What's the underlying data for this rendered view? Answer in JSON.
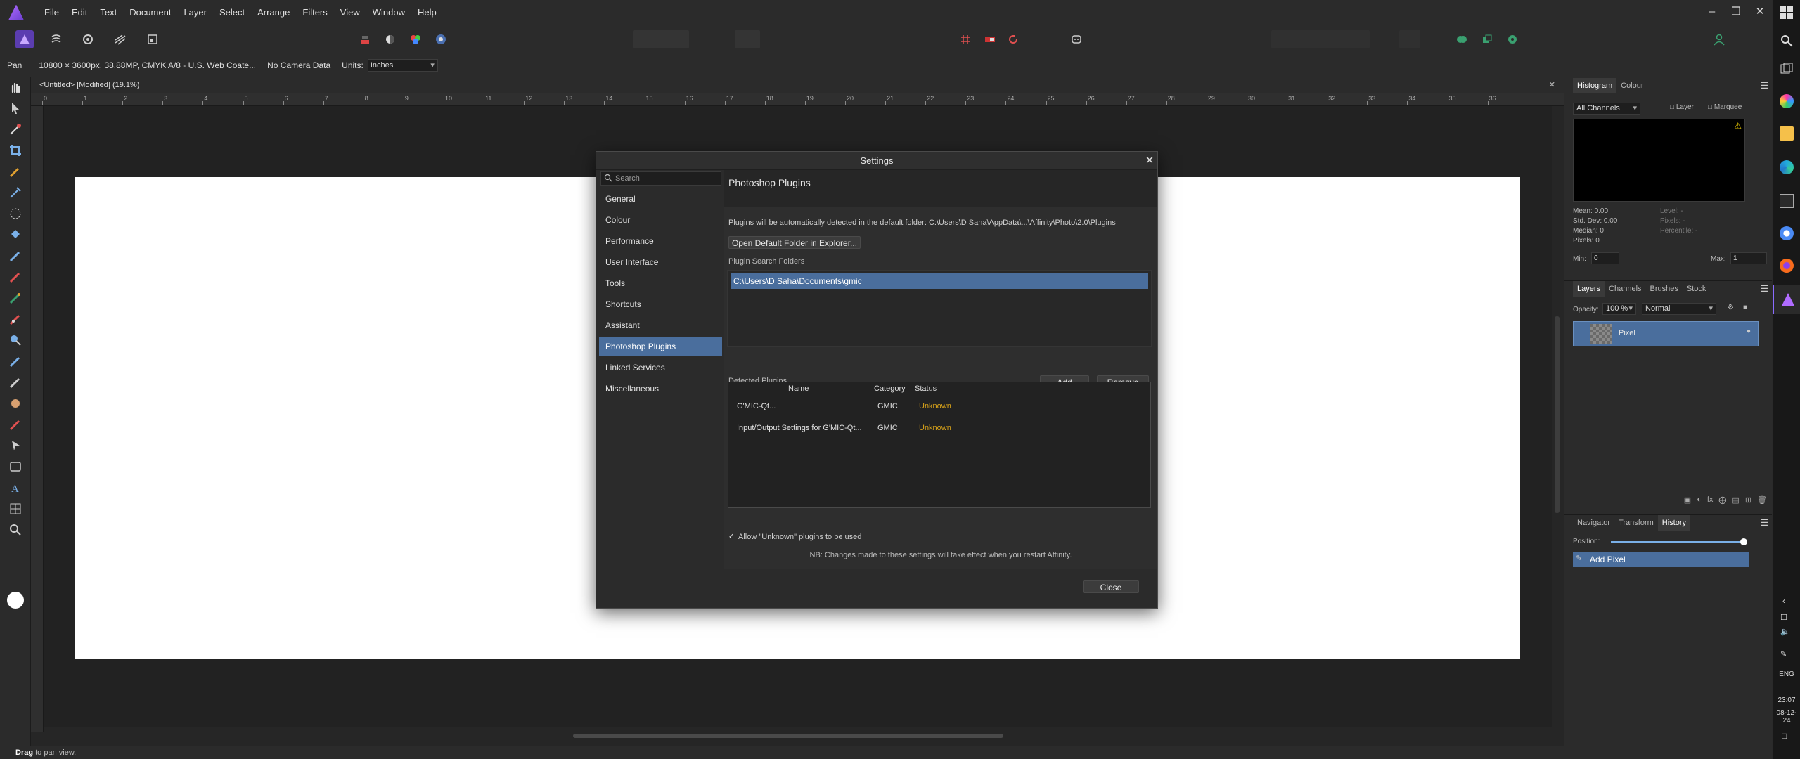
{
  "menu": [
    "File",
    "Edit",
    "Text",
    "Document",
    "Layer",
    "Select",
    "Arrange",
    "Filters",
    "View",
    "Window",
    "Help"
  ],
  "context_bar": {
    "tool_name": "Pan",
    "doc_info": "10800 × 3600px, 38.88MP, CMYK A/8 - U.S. Web Coate...",
    "camera": "No Camera Data",
    "units_label": "Units:",
    "units_value": "Inches"
  },
  "document": {
    "tab_title": "<Untitled> [Modified] (19.1%)",
    "ruler_ticks": [
      "0",
      "1",
      "2",
      "3",
      "4",
      "5",
      "6",
      "7",
      "8",
      "9",
      "10",
      "11",
      "12",
      "13",
      "14",
      "15",
      "16",
      "17",
      "18",
      "19",
      "20",
      "21",
      "22",
      "23",
      "24",
      "25",
      "26",
      "27",
      "28",
      "29",
      "30",
      "31",
      "32",
      "33",
      "34",
      "35",
      "36"
    ]
  },
  "status_bar": {
    "bold": "Drag",
    "rest": " to pan view."
  },
  "settings": {
    "title": "Settings",
    "search_placeholder": "Search",
    "nav": [
      "General",
      "Colour",
      "Performance",
      "User Interface",
      "Tools",
      "Shortcuts",
      "Assistant",
      "Photoshop Plugins",
      "Linked Services",
      "Miscellaneous"
    ],
    "selected_nav": "Photoshop Plugins",
    "page_title": "Photoshop Plugins",
    "default_folder_text": "Plugins will be automatically detected in the default folder: C:\\Users\\D Saha\\AppData\\...\\Affinity\\Photo\\2.0\\Plugins",
    "open_folder_button": "Open Default Folder in Explorer...",
    "search_folders_label": "Plugin Search Folders",
    "folders": [
      "C:\\Users\\D Saha\\Documents\\gmic"
    ],
    "detected_label": "Detected Plugins",
    "add_button": "Add",
    "remove_button": "Remove",
    "columns": [
      "Name",
      "Category",
      "Status"
    ],
    "plugins": [
      {
        "name": "G'MIC-Qt...",
        "category": "GMIC",
        "status": "Unknown"
      },
      {
        "name": "Input/Output Settings for G'MIC-Qt...",
        "category": "GMIC",
        "status": "Unknown"
      }
    ],
    "allow_unknown_label": "Allow \"Unknown\" plugins to be used",
    "allow_unknown_checked": true,
    "restart_note": "NB: Changes made to these settings will take effect when you restart Affinity.",
    "close_button": "Close"
  },
  "histogram": {
    "tabs": [
      "Histogram",
      "Colour"
    ],
    "channel": "All Channels",
    "layer_label": "Layer",
    "marquee_label": "Marquee",
    "stats_left": [
      "Mean: 0.00",
      "Std. Dev: 0.00",
      "Median: 0",
      "Pixels: 0"
    ],
    "stats_right": [
      "Level: -",
      "Pixels: -",
      "Percentile: -"
    ],
    "min_label": "Min:",
    "min_value": "0",
    "max_label": "Max:",
    "max_value": "1"
  },
  "layers": {
    "tabs": [
      "Layers",
      "Channels",
      "Brushes",
      "Stock"
    ],
    "opacity_label": "Opacity:",
    "opacity_value": "100 %",
    "blend_mode": "Normal",
    "items": [
      {
        "name": "Pixel"
      }
    ]
  },
  "history": {
    "tabs": [
      "Navigator",
      "Transform",
      "History"
    ],
    "position_label": "Position:",
    "items": [
      "Add Pixel"
    ]
  },
  "taskbar": {
    "lang": "ENG",
    "time": "23:07",
    "date": "08-12-24"
  },
  "colors": {
    "accent": "#5b3db0",
    "selection": "#4a6e9d",
    "unknown_status": "#d9a31a"
  }
}
